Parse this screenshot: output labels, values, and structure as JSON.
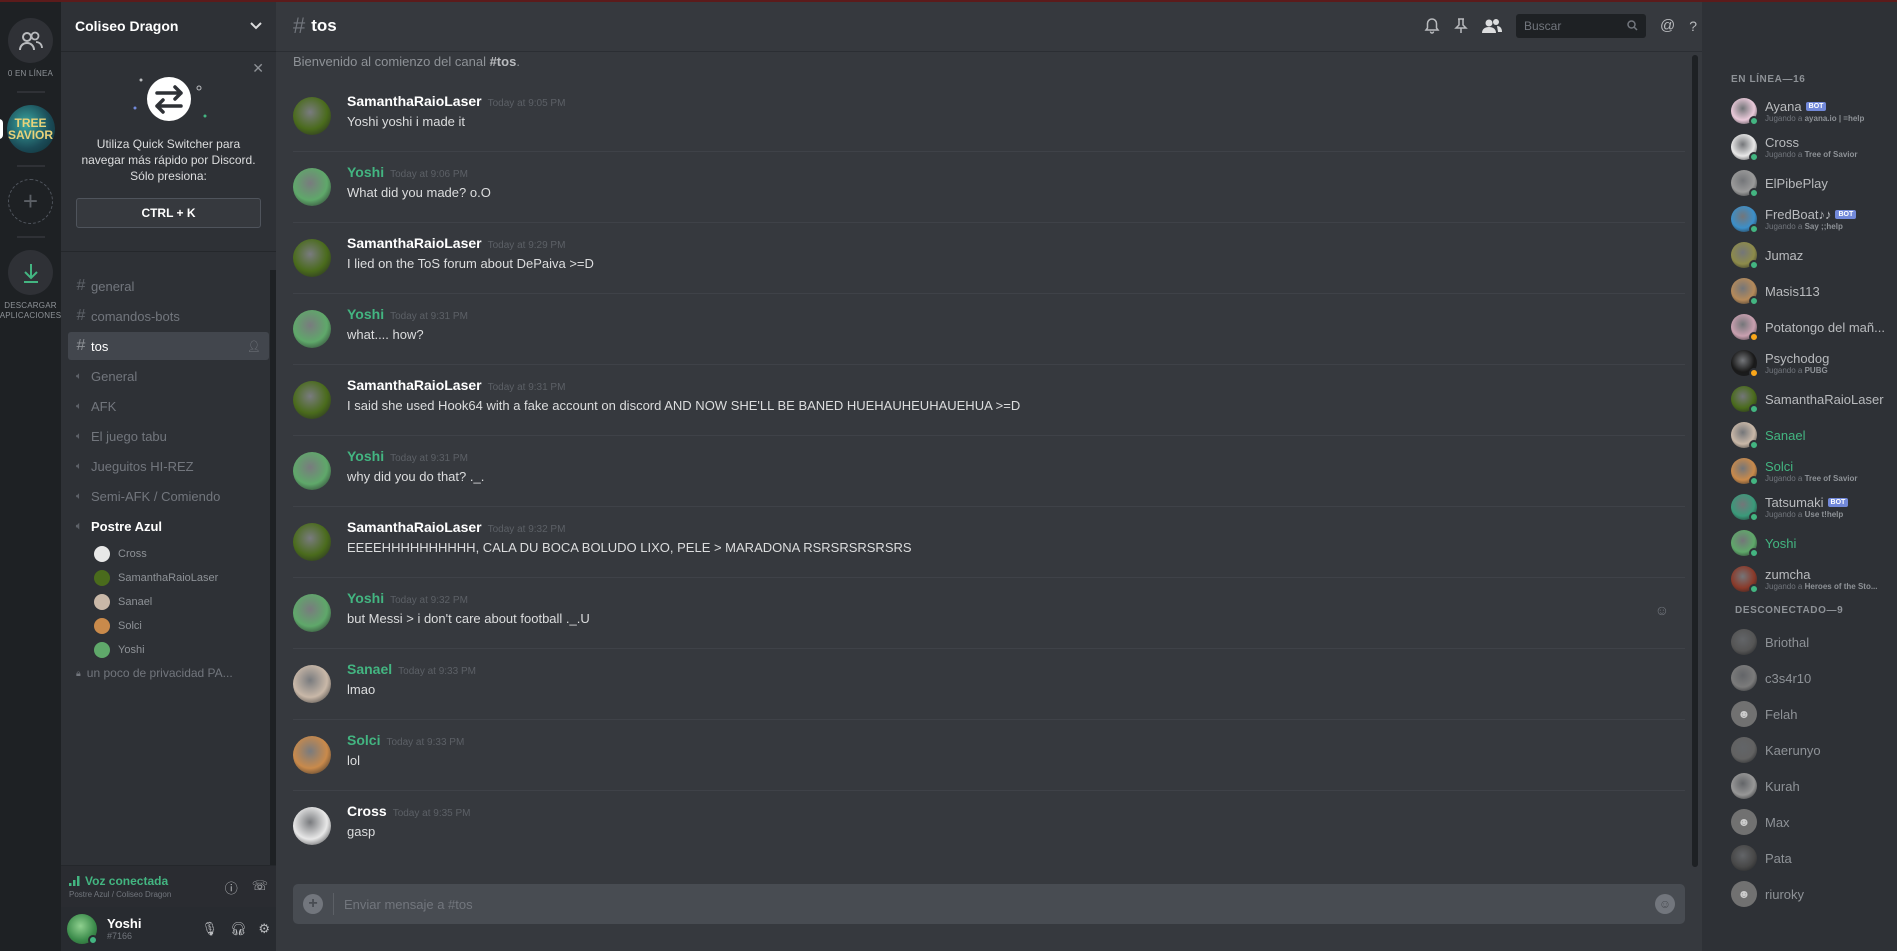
{
  "rail": {
    "online_label": "0 EN LÍNEA",
    "download_label_1": "DESCARGAR",
    "download_label_2": "APLICACIONES",
    "server_icon_text": "TREE SAVIOR"
  },
  "guild": {
    "name": "Coliseo Dragon"
  },
  "switcher": {
    "text_1": "Utiliza Quick Switcher para",
    "text_2": "navegar más rápido por Discord.",
    "text_3": "Sólo presiona:",
    "shortcut": "CTRL + K"
  },
  "channels": [
    {
      "name": "general",
      "kind": "text"
    },
    {
      "name": "comandos-bots",
      "kind": "text"
    },
    {
      "name": "tos",
      "kind": "text",
      "active": true
    },
    {
      "name": "General",
      "kind": "voice"
    },
    {
      "name": "AFK",
      "kind": "voice"
    },
    {
      "name": "El juego tabu",
      "kind": "voice"
    },
    {
      "name": "Jueguitos HI-REZ",
      "kind": "voice"
    },
    {
      "name": "Semi-AFK / Comiendo",
      "kind": "voice"
    },
    {
      "name": "Postre Azul",
      "kind": "voice",
      "bold": true
    }
  ],
  "voice_users": [
    {
      "name": "Cross",
      "color": "#e8e8e8"
    },
    {
      "name": "SamanthaRaioLaser",
      "color": "#4a6b1c"
    },
    {
      "name": "Sanael",
      "color": "#c9b8a8"
    },
    {
      "name": "Solci",
      "color": "#c98a4b"
    },
    {
      "name": "Yoshi",
      "color": "#5fa86a"
    }
  ],
  "locked_channel": "un poco de privacidad PA...",
  "voice_status": {
    "label": "Voz conectada",
    "location": "Postre Azul / Coliseo Dragon"
  },
  "user": {
    "name": "Yoshi",
    "tag": "#7166"
  },
  "chat": {
    "channel": "tos",
    "search_placeholder": "Buscar",
    "welcome_prefix": "Bienvenido al comienzo del canal ",
    "welcome_channel": "#tos",
    "welcome_suffix": ".",
    "composer_placeholder": "Enviar mensaje a #tos"
  },
  "messages": [
    {
      "author": "SamanthaRaioLaser",
      "time": "Today at 9:05 PM",
      "text": "Yoshi yoshi i made it",
      "green": false,
      "avatar": "#4a6b1c"
    },
    {
      "author": "Yoshi",
      "time": "Today at 9:06 PM",
      "text": "What did you made? o.O",
      "green": true,
      "avatar": "#5fa86a"
    },
    {
      "author": "SamanthaRaioLaser",
      "time": "Today at 9:29 PM",
      "text": "I lied on the ToS forum about DePaiva >=D",
      "green": false,
      "avatar": "#4a6b1c"
    },
    {
      "author": "Yoshi",
      "time": "Today at 9:31 PM",
      "text": "what.... how?",
      "green": true,
      "avatar": "#5fa86a"
    },
    {
      "author": "SamanthaRaioLaser",
      "time": "Today at 9:31 PM",
      "text": "I said she used Hook64 with a fake account on discord AND NOW SHE'LL BE BANED HUEHAUHEUHAUEHUA >=D",
      "green": false,
      "avatar": "#4a6b1c"
    },
    {
      "author": "Yoshi",
      "time": "Today at 9:31 PM",
      "text": "why did you do that? ._.",
      "green": true,
      "avatar": "#5fa86a"
    },
    {
      "author": "SamanthaRaioLaser",
      "time": "Today at 9:32 PM",
      "text": "EEEEHHHHHHHHHH, CALA DU BOCA BOLUDO LIXO, PELE > MARADONA RSRSRSRSRSRS",
      "green": false,
      "avatar": "#4a6b1c"
    },
    {
      "author": "Yoshi",
      "time": "Today at 9:32 PM",
      "text": "but Messi > i don't care about football ._.U",
      "green": true,
      "avatar": "#5fa86a"
    },
    {
      "author": "Sanael",
      "time": "Today at 9:33 PM",
      "text": "lmao",
      "green": true,
      "avatar": "#c9b8a8"
    },
    {
      "author": "Solci",
      "time": "Today at 9:33 PM",
      "text": "lol",
      "green": true,
      "avatar": "#c98a4b"
    },
    {
      "author": "Cross",
      "time": "Today at 9:35 PM",
      "text": "gasp",
      "green": false,
      "avatar": "#e8e8e8"
    }
  ],
  "members": {
    "online_header": "EN LÍNEA—16",
    "offline_header": "DESCONECTADO—9",
    "online": [
      {
        "name": "Ayana",
        "bot": true,
        "sub_prefix": "Jugando a ",
        "sub_game": "ayana.io | =help",
        "green": false,
        "avatar": "#e9c9d9",
        "status": "#43b581"
      },
      {
        "name": "Cross",
        "bot": false,
        "sub_prefix": "Jugando a ",
        "sub_game": "Tree of Savior",
        "green": false,
        "avatar": "#e8e8e8",
        "status": "#43b581"
      },
      {
        "name": "ElPibePlay",
        "bot": false,
        "sub_prefix": "",
        "sub_game": "",
        "green": false,
        "avatar": "#9a9a9a",
        "status": "#43b581"
      },
      {
        "name": "FredBoat♪♪",
        "bot": true,
        "sub_prefix": "Jugando a ",
        "sub_game": "Say ;;help",
        "green": false,
        "avatar": "#3c8fc9",
        "status": "#43b581"
      },
      {
        "name": "Jumaz",
        "bot": false,
        "sub_prefix": "",
        "sub_game": "",
        "green": false,
        "avatar": "#8d8b4a",
        "status": "#43b581"
      },
      {
        "name": "Masis113",
        "bot": false,
        "sub_prefix": "",
        "sub_game": "",
        "green": false,
        "avatar": "#b58a5a",
        "status": "#43b581"
      },
      {
        "name": "Potatongo del mañ...",
        "bot": false,
        "sub_prefix": "",
        "sub_game": "",
        "green": false,
        "avatar": "#c9a0b0",
        "status": "#faa61a"
      },
      {
        "name": "Psychodog",
        "bot": false,
        "sub_prefix": "Jugando a ",
        "sub_game": "PUBG",
        "green": false,
        "avatar": "#1a1a1a",
        "status": "#faa61a"
      },
      {
        "name": "SamanthaRaioLaser",
        "bot": false,
        "sub_prefix": "",
        "sub_game": "",
        "green": false,
        "avatar": "#4a6b1c",
        "status": "#43b581"
      },
      {
        "name": "Sanael",
        "bot": false,
        "sub_prefix": "",
        "sub_game": "",
        "green": true,
        "avatar": "#c9b8a8",
        "status": "#43b581"
      },
      {
        "name": "Solci",
        "bot": false,
        "sub_prefix": "Jugando a ",
        "sub_game": "Tree of Savior",
        "green": true,
        "avatar": "#c98a4b",
        "status": "#43b581"
      },
      {
        "name": "Tatsumaki",
        "bot": true,
        "sub_prefix": "Jugando a ",
        "sub_game": "Use t!help",
        "green": false,
        "avatar": "#3a9a7a",
        "status": "#43b581"
      },
      {
        "name": "Yoshi",
        "bot": false,
        "sub_prefix": "",
        "sub_game": "",
        "green": true,
        "avatar": "#5fa86a",
        "status": "#43b581"
      },
      {
        "name": "zumcha",
        "bot": false,
        "sub_prefix": "Jugando a ",
        "sub_game": "Heroes of the Sto...",
        "green": false,
        "avatar": "#8a3a2a",
        "status": "#43b581"
      }
    ],
    "offline": [
      {
        "name": "Briothal",
        "avatar": "#6a6a6a",
        "discord": false
      },
      {
        "name": "c3s4r10",
        "avatar": "#9a9a9a",
        "discord": false
      },
      {
        "name": "Felah",
        "avatar": "#8a8e94",
        "discord": true
      },
      {
        "name": "Kaerunyo",
        "avatar": "#7a7a7a",
        "discord": false
      },
      {
        "name": "Kurah",
        "avatar": "#bdbdbd",
        "discord": false
      },
      {
        "name": "Max",
        "avatar": "#8a8e94",
        "discord": true
      },
      {
        "name": "Pata",
        "avatar": "#5a5a5a",
        "discord": false
      },
      {
        "name": "riuroky",
        "avatar": "#8a8e94",
        "discord": true
      }
    ]
  }
}
